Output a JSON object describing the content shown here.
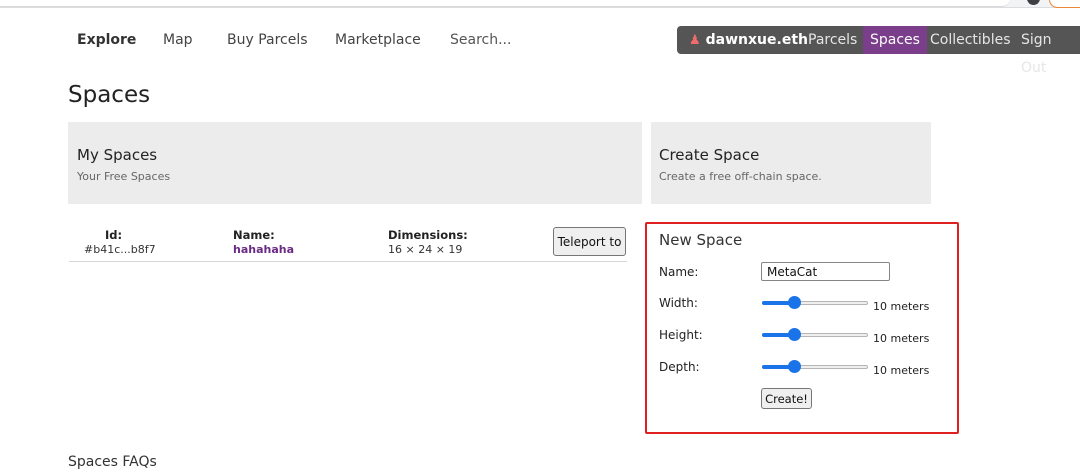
{
  "nav": {
    "explore": "Explore",
    "map": "Map",
    "buy_parcels": "Buy Parcels",
    "marketplace": "Marketplace",
    "search": "Search..."
  },
  "account": {
    "username": "dawnxue.eth",
    "parcels": "Parcels",
    "spaces": "Spaces",
    "collectibles": "Collectibles",
    "sign_out": "Sign Out",
    "user_icon": "user-icon"
  },
  "page": {
    "title": "Spaces"
  },
  "my_spaces": {
    "title": "My Spaces",
    "subtitle": "Your Free Spaces"
  },
  "create_space": {
    "title": "Create Space",
    "subtitle": "Create a free off-chain space."
  },
  "table": {
    "headers": {
      "id": "Id:",
      "name": "Name:",
      "dimensions": "Dimensions:"
    },
    "rows": [
      {
        "id": "#b41c...b8f7",
        "name": "hahahaha",
        "dimensions": "16 × 24 × 19",
        "action": "Teleport to"
      }
    ]
  },
  "new_space": {
    "title": "New Space",
    "name_label": "Name:",
    "name_value": "MetaCat",
    "width_label": "Width:",
    "width_value": "10 meters",
    "width_level": 0.28,
    "height_label": "Height:",
    "height_value": "10 meters",
    "height_level": 0.28,
    "depth_label": "Depth:",
    "depth_value": "10 meters",
    "depth_level": 0.28,
    "create_label": "Create!"
  },
  "footer": {
    "faqs": "Spaces FAQs"
  },
  "colors": {
    "accent": "#1a73e8",
    "highlight_border": "#e02020",
    "spaces_tab": "#7a3e8a",
    "name_link": "#6a2a86"
  }
}
